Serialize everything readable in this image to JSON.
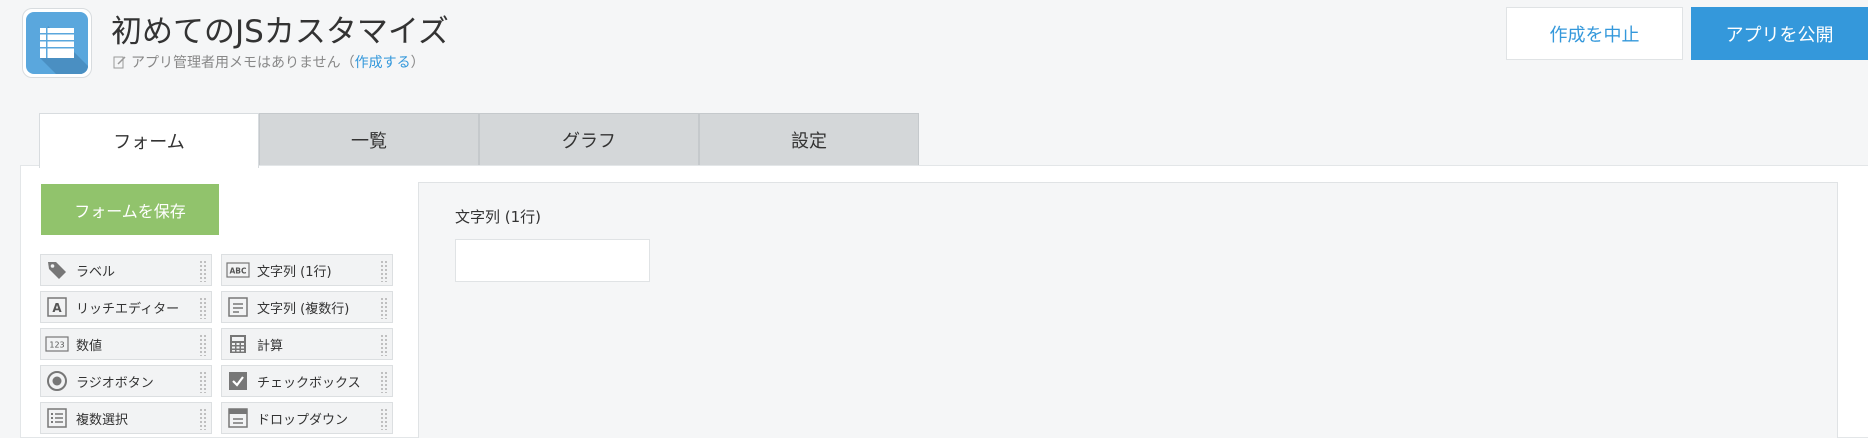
{
  "header": {
    "title": "初めてのJSカスタマイズ",
    "memo_text": "アプリ管理者用メモはありません（",
    "memo_link": "作成する",
    "memo_close": "）",
    "cancel_label": "作成を中止",
    "publish_label": "アプリを公開"
  },
  "tabs": [
    {
      "label": "フォーム",
      "active": true
    },
    {
      "label": "一覧",
      "active": false
    },
    {
      "label": "グラフ",
      "active": false
    },
    {
      "label": "設定",
      "active": false
    }
  ],
  "form": {
    "save_label": "フォームを保存",
    "palette": [
      {
        "label": "ラベル",
        "icon": "tag-icon"
      },
      {
        "label": "文字列 (1行)",
        "icon": "abc-icon"
      },
      {
        "label": "リッチエディター",
        "icon": "rich-editor-icon"
      },
      {
        "label": "文字列 (複数行)",
        "icon": "multiline-text-icon"
      },
      {
        "label": "数値",
        "icon": "number-icon"
      },
      {
        "label": "計算",
        "icon": "calculator-icon"
      },
      {
        "label": "ラジオボタン",
        "icon": "radio-icon"
      },
      {
        "label": "チェックボックス",
        "icon": "checkbox-icon"
      },
      {
        "label": "複数選択",
        "icon": "multi-select-icon"
      },
      {
        "label": "ドロップダウン",
        "icon": "dropdown-icon"
      }
    ],
    "canvas_field": {
      "label": "文字列 (1行)",
      "value": ""
    }
  },
  "colors": {
    "accent": "#3498db",
    "save": "#91c36c",
    "tab_inactive": "#d4d7d9"
  }
}
